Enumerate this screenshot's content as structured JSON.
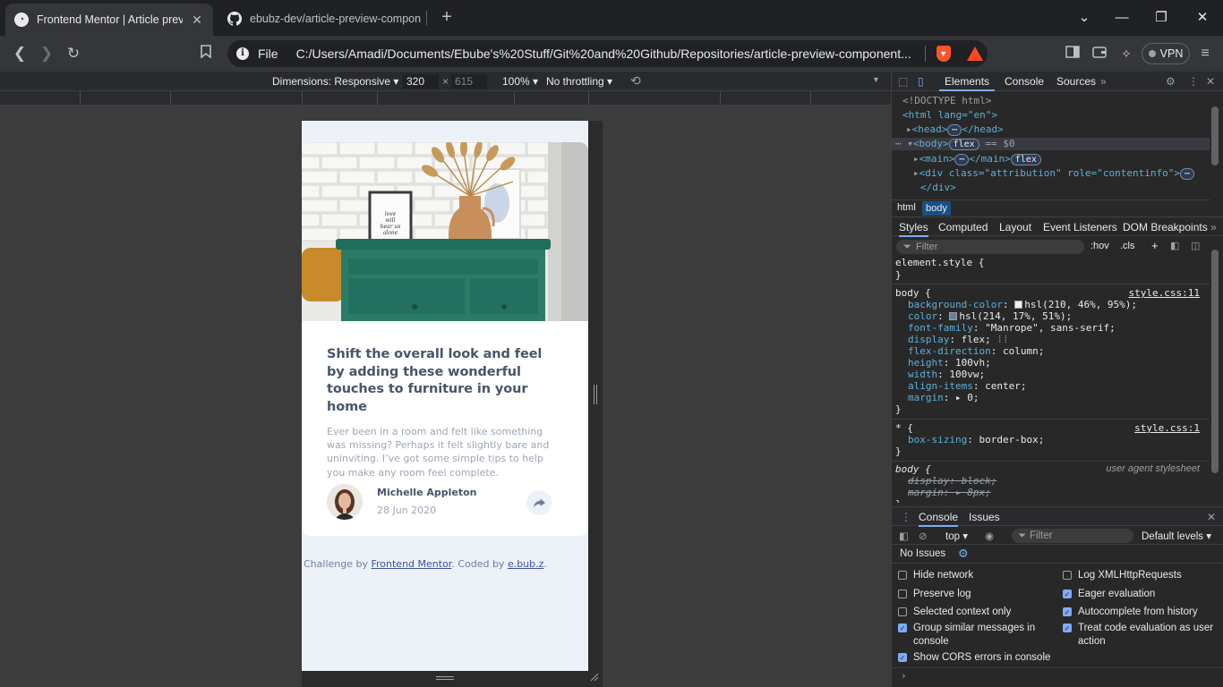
{
  "browser": {
    "tabs": [
      {
        "title": "Frontend Mentor | Article preview component",
        "active": true
      },
      {
        "title": "ebubz-dev/article-preview-component",
        "active": false
      }
    ],
    "address": {
      "scheme_label": "File",
      "url": "C:/Users/Amadi/Documents/Ebube's%20Stuff/Git%20and%20Github/Repositories/article-preview-component..."
    },
    "vpn_label": "VPN"
  },
  "device_toolbar": {
    "dimensions_label": "Dimensions: Responsive",
    "width": "320",
    "height": "615",
    "times": "×",
    "zoom": "100%",
    "throttling": "No throttling"
  },
  "article": {
    "headline": "Shift the overall look and feel by adding these wonderful touches to furniture in your home",
    "description": "Ever been in a room and felt like something was missing? Perhaps it felt slightly bare and uninviting. I’ve got some simple tips to help you make any room feel complete.",
    "author_name": "Michelle Appleton",
    "date": "28 Jun 2020",
    "frame_text": "Love will bear us alone"
  },
  "attribution": {
    "prefix": "Challenge by ",
    "link1": "Frontend Mentor",
    "middle": ". Coded by ",
    "link2": "e.bub.z",
    "suffix": "."
  },
  "devtools": {
    "tabs": [
      "Elements",
      "Console",
      "Sources"
    ],
    "dom": {
      "doctype": "<!DOCTYPE html>",
      "html_open": "<html lang=\"en\">",
      "head": "<head>",
      "head_close": "</head>",
      "body": "<body>",
      "body_eq": "== $0",
      "main": "<main>",
      "main_close": "</main>",
      "div_open": "<div class=\"attribution\" role=\"contentinfo\">",
      "div_close": "</div>",
      "flex_badge": "flex",
      "ellipsis": "⋯"
    },
    "breadcrumbs": [
      "html",
      "body"
    ],
    "style_tabs": [
      "Styles",
      "Computed",
      "Layout",
      "Event Listeners",
      "DOM Breakpoints"
    ],
    "filter_placeholder": "Filter",
    "hov": ":hov",
    "cls": ".cls",
    "rules": {
      "element_style": "element.style {",
      "close": "}",
      "body_selector": "body {",
      "body_source": "style.css:11",
      "body_props": [
        {
          "name": "background-color",
          "value": "hsl(210, 46%, 95%);",
          "swatch": "#eef2f7"
        },
        {
          "name": "color",
          "value": "hsl(214, 17%, 51%);",
          "swatch": "#6c7f99"
        },
        {
          "name": "font-family",
          "value": "\"Manrope\", sans-serif;"
        },
        {
          "name": "display",
          "value": "flex;"
        },
        {
          "name": "flex-direction",
          "value": "column;"
        },
        {
          "name": "height",
          "value": "100vh;"
        },
        {
          "name": "width",
          "value": "100vw;"
        },
        {
          "name": "align-items",
          "value": "center;"
        },
        {
          "name": "margin",
          "value": "▸ 0;"
        }
      ],
      "star_selector": "* {",
      "star_source": "style.css:1",
      "star_prop": {
        "name": "box-sizing",
        "value": "border-box;"
      },
      "ua_selector": "body {",
      "ua_label": "user agent stylesheet",
      "ua_props": [
        "display: block;",
        "margin: ▸ 8px;"
      ]
    },
    "drawer_tabs": [
      "Console",
      "Issues"
    ],
    "console": {
      "context": "top",
      "filter_placeholder": "Filter",
      "levels": "Default levels",
      "no_issues": "No Issues"
    },
    "settings": [
      {
        "label": "Hide network",
        "checked": false
      },
      {
        "label": "Log XMLHttpRequests",
        "checked": false
      },
      {
        "label": "Preserve log",
        "checked": false
      },
      {
        "label": "Eager evaluation",
        "checked": true
      },
      {
        "label": "Selected context only",
        "checked": false
      },
      {
        "label": "Autocomplete from history",
        "checked": true
      },
      {
        "label": "Group similar messages in console",
        "checked": true
      },
      {
        "label": "Treat code evaluation as user action",
        "checked": true
      },
      {
        "label": "Show CORS errors in console",
        "checked": true
      }
    ]
  }
}
